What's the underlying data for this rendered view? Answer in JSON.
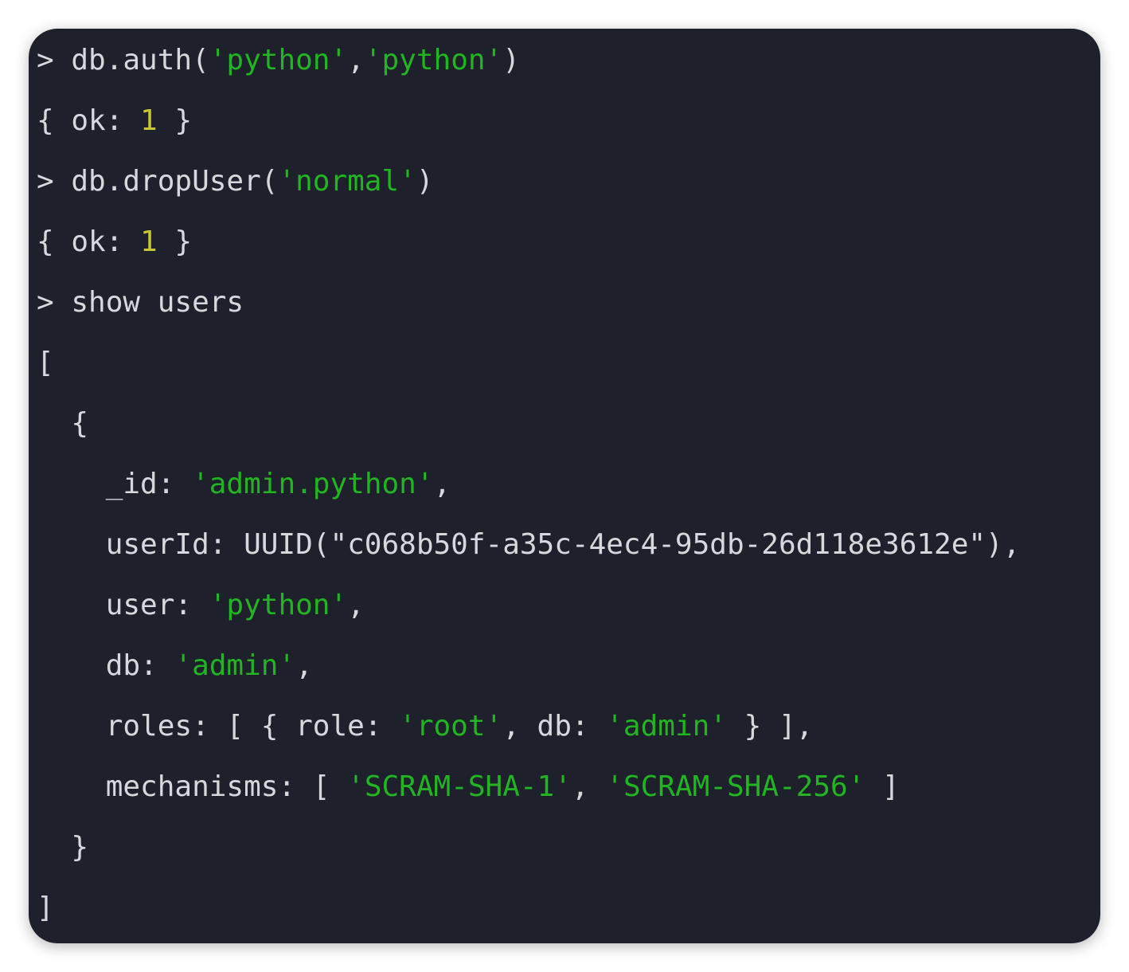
{
  "terminal": {
    "lines": [
      {
        "segments": [
          {
            "text": "> db.auth(",
            "kind": "plain"
          },
          {
            "text": "'python'",
            "kind": "string"
          },
          {
            "text": ",",
            "kind": "plain"
          },
          {
            "text": "'python'",
            "kind": "string"
          },
          {
            "text": ")",
            "kind": "plain"
          }
        ]
      },
      {
        "segments": [
          {
            "text": "{ ok: ",
            "kind": "plain"
          },
          {
            "text": "1",
            "kind": "number"
          },
          {
            "text": " }",
            "kind": "plain"
          }
        ]
      },
      {
        "segments": [
          {
            "text": "> db.dropUser(",
            "kind": "plain"
          },
          {
            "text": "'normal'",
            "kind": "string"
          },
          {
            "text": ")",
            "kind": "plain"
          }
        ]
      },
      {
        "segments": [
          {
            "text": "{ ok: ",
            "kind": "plain"
          },
          {
            "text": "1",
            "kind": "number"
          },
          {
            "text": " }",
            "kind": "plain"
          }
        ]
      },
      {
        "segments": [
          {
            "text": "> show users",
            "kind": "plain"
          }
        ]
      },
      {
        "segments": [
          {
            "text": "[",
            "kind": "plain"
          }
        ]
      },
      {
        "segments": [
          {
            "text": "  {",
            "kind": "plain"
          }
        ]
      },
      {
        "segments": [
          {
            "text": "    _id: ",
            "kind": "plain"
          },
          {
            "text": "'admin.python'",
            "kind": "string"
          },
          {
            "text": ",",
            "kind": "plain"
          }
        ]
      },
      {
        "segments": [
          {
            "text": "    userId: UUID(\"c068b50f-a35c-4ec4-95db-26d118e3612e\"),",
            "kind": "plain"
          }
        ]
      },
      {
        "segments": [
          {
            "text": "    user: ",
            "kind": "plain"
          },
          {
            "text": "'python'",
            "kind": "string"
          },
          {
            "text": ",",
            "kind": "plain"
          }
        ]
      },
      {
        "segments": [
          {
            "text": "    db: ",
            "kind": "plain"
          },
          {
            "text": "'admin'",
            "kind": "string"
          },
          {
            "text": ",",
            "kind": "plain"
          }
        ]
      },
      {
        "segments": [
          {
            "text": "    roles: [ { role: ",
            "kind": "plain"
          },
          {
            "text": "'root'",
            "kind": "string"
          },
          {
            "text": ", db: ",
            "kind": "plain"
          },
          {
            "text": "'admin'",
            "kind": "string"
          },
          {
            "text": " } ],",
            "kind": "plain"
          }
        ]
      },
      {
        "segments": [
          {
            "text": "    mechanisms: [ ",
            "kind": "plain"
          },
          {
            "text": "'SCRAM-SHA-1'",
            "kind": "string"
          },
          {
            "text": ", ",
            "kind": "plain"
          },
          {
            "text": "'SCRAM-SHA-256'",
            "kind": "string"
          },
          {
            "text": " ]",
            "kind": "plain"
          }
        ]
      },
      {
        "segments": [
          {
            "text": "  }",
            "kind": "plain"
          }
        ]
      },
      {
        "segments": [
          {
            "text": "]",
            "kind": "plain"
          }
        ]
      }
    ]
  },
  "colors": {
    "background": "#1e212c",
    "text": "#d7d8dc",
    "string": "#22b422",
    "number": "#c8c53a"
  }
}
